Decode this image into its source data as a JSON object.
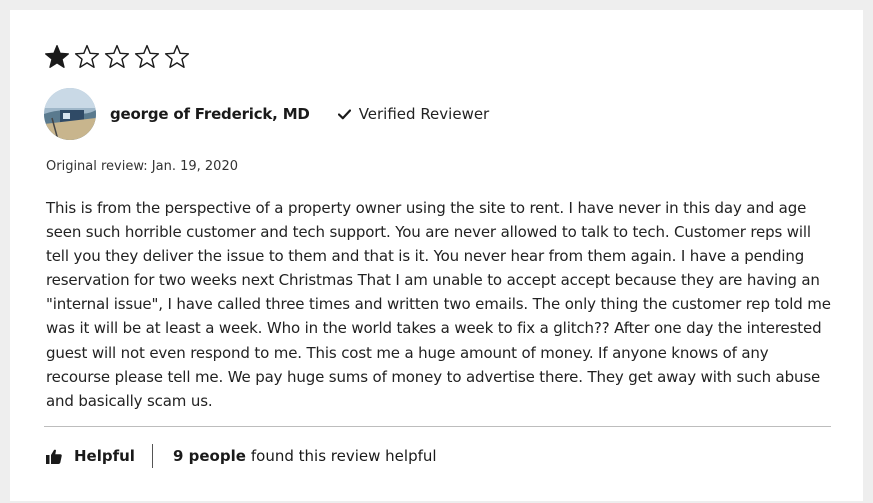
{
  "review": {
    "rating": 1,
    "max_rating": 5,
    "reviewer_name": "george of Frederick, MD",
    "verified_label": "Verified Reviewer",
    "date_text": "Original review: Jan. 19, 2020",
    "body_lines": [
      "This is from the perspective of a property owner using the site to rent. I have never in this day and age",
      "seen such horrible customer and tech support. You are never allowed to talk to tech. Customer reps will",
      "tell you they deliver the issue to them and that is it. You never hear from them again. I have a pending",
      "reservation for two weeks next Christmas That I am unable to accept accept because they are having an",
      "\"internal issue\", I have called three times and written two emails. The only thing the customer rep told me",
      "was it will be at least a week. Who in the world takes a week to fix a glitch?? After one day the interested",
      "guest will not even respond to me. This cost me a huge amount of money. If anyone knows of any",
      "recourse please tell me. We pay huge sums of money to advertise there. They get away with such abuse",
      "and basically scam us."
    ],
    "helpful_label": "Helpful",
    "helpful_count": "9 people",
    "helpful_suffix": "found this review helpful"
  },
  "icons": {
    "star_filled": "star-filled-icon",
    "star_empty": "star-outline-icon",
    "verified": "checkmark-icon",
    "helpful": "thumbs-up-icon"
  },
  "colors": {
    "star": "#1a1a1a",
    "background": "#eeeeee",
    "card": "#ffffff",
    "divider": "#bdbdbd"
  }
}
